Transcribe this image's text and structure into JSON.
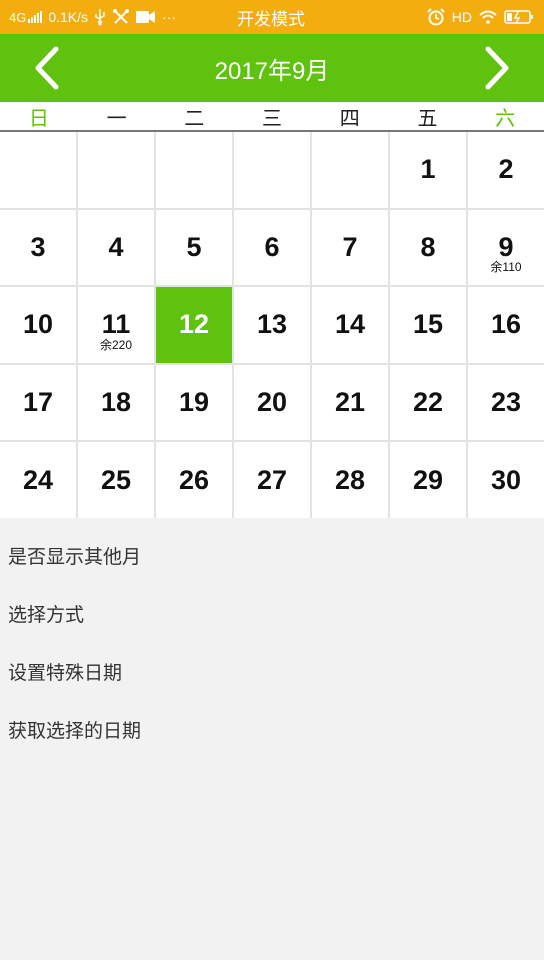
{
  "status_bar": {
    "network": "4G",
    "speed": "0.1K/s",
    "dots": "···",
    "developer_mode": "开发模式",
    "hd": "HD",
    "colors": {
      "background": "#f4ad0f",
      "text": "#ffffff"
    }
  },
  "header": {
    "title": "2017年9月",
    "prev_icon": "chevron-left-icon",
    "next_icon": "chevron-right-icon",
    "color": "#5fc20e"
  },
  "weekdays": [
    "日",
    "一",
    "二",
    "三",
    "四",
    "五",
    "六"
  ],
  "calendar": {
    "selected_day": "12",
    "days": [
      {
        "num": "",
        "note": ""
      },
      {
        "num": "",
        "note": ""
      },
      {
        "num": "",
        "note": ""
      },
      {
        "num": "",
        "note": ""
      },
      {
        "num": "",
        "note": ""
      },
      {
        "num": "1",
        "note": ""
      },
      {
        "num": "2",
        "note": ""
      },
      {
        "num": "3",
        "note": ""
      },
      {
        "num": "4",
        "note": ""
      },
      {
        "num": "5",
        "note": ""
      },
      {
        "num": "6",
        "note": ""
      },
      {
        "num": "7",
        "note": ""
      },
      {
        "num": "8",
        "note": ""
      },
      {
        "num": "9",
        "note": "余110"
      },
      {
        "num": "10",
        "note": ""
      },
      {
        "num": "11",
        "note": "余220"
      },
      {
        "num": "12",
        "note": ""
      },
      {
        "num": "13",
        "note": ""
      },
      {
        "num": "14",
        "note": ""
      },
      {
        "num": "15",
        "note": ""
      },
      {
        "num": "16",
        "note": ""
      },
      {
        "num": "17",
        "note": ""
      },
      {
        "num": "18",
        "note": ""
      },
      {
        "num": "19",
        "note": ""
      },
      {
        "num": "20",
        "note": ""
      },
      {
        "num": "21",
        "note": ""
      },
      {
        "num": "22",
        "note": ""
      },
      {
        "num": "23",
        "note": ""
      },
      {
        "num": "24",
        "note": ""
      },
      {
        "num": "25",
        "note": ""
      },
      {
        "num": "26",
        "note": ""
      },
      {
        "num": "27",
        "note": ""
      },
      {
        "num": "28",
        "note": ""
      },
      {
        "num": "29",
        "note": ""
      },
      {
        "num": "30",
        "note": ""
      }
    ]
  },
  "options": [
    "是否显示其他月",
    "选择方式",
    "设置特殊日期",
    "获取选择的日期"
  ]
}
